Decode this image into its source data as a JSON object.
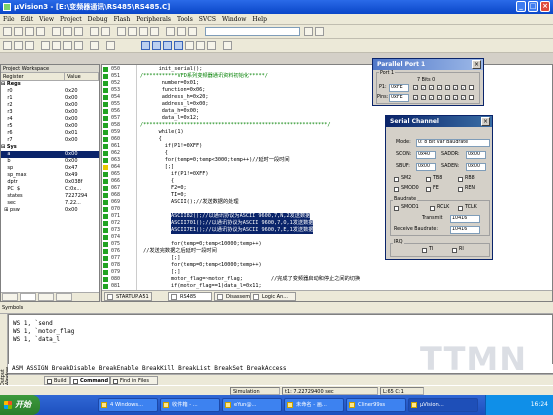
{
  "window": {
    "app_name": "RS485",
    "title": "μVision3 - [E:\\变频器通讯\\RS485\\RS485.C]",
    "controls": {
      "minimize": "_",
      "maximize": "□",
      "close": "×"
    }
  },
  "menu": [
    "File",
    "Edit",
    "View",
    "Project",
    "Debug",
    "Flash",
    "Peripherals",
    "Tools",
    "SVCS",
    "Window",
    "Help"
  ],
  "workspace": {
    "title": "Project Workspace",
    "col_register": "Register",
    "col_value": "Value",
    "rows": [
      {
        "name": "⊟ Regs",
        "value": "",
        "group": true
      },
      {
        "name": "    r0",
        "value": "0x20"
      },
      {
        "name": "    r1",
        "value": "0x00"
      },
      {
        "name": "    r2",
        "value": "0x00"
      },
      {
        "name": "    r3",
        "value": "0x00"
      },
      {
        "name": "    r4",
        "value": "0x00"
      },
      {
        "name": "    r5",
        "value": "0x00"
      },
      {
        "name": "    r6",
        "value": "0x01"
      },
      {
        "name": "    r7",
        "value": "0x00"
      },
      {
        "name": "⊟ Sys",
        "value": "",
        "group": true
      },
      {
        "name": "    a",
        "value": "0x00",
        "selected": true
      },
      {
        "name": "    b",
        "value": "0x00"
      },
      {
        "name": "    sp",
        "value": "0x47"
      },
      {
        "name": "    sp_max",
        "value": "0x49"
      },
      {
        "name": "    dptr",
        "value": "0x038f"
      },
      {
        "name": "    PC  $",
        "value": "C:0x..."
      },
      {
        "name": "    states",
        "value": "7227294"
      },
      {
        "name": "    sec",
        "value": "7.22..."
      },
      {
        "name": "  ⊞ psw",
        "value": "0x00"
      }
    ]
  },
  "editor": {
    "lines": [
      {
        "n": "050",
        "text": "init_serial();",
        "indent": 6
      },
      {
        "n": "051",
        "text": "/***********VFD系列变频器通讯资料初始化*****/",
        "indent": 0,
        "cls": "green"
      },
      {
        "n": "052",
        "text": "number=0x01;",
        "indent": 7
      },
      {
        "n": "053",
        "text": "function=0x06;",
        "indent": 7
      },
      {
        "n": "054",
        "text": "address_h=0x20;",
        "indent": 7
      },
      {
        "n": "055",
        "text": "address_l=0x00;",
        "indent": 7
      },
      {
        "n": "056",
        "text": "data_h=0x00;",
        "indent": 7
      },
      {
        "n": "057",
        "text": "data_l=0x12;",
        "indent": 7
      },
      {
        "n": "058",
        "text": "/***********************************************************/",
        "indent": 0,
        "cls": "green"
      },
      {
        "n": "059",
        "text": "while(1)",
        "indent": 6
      },
      {
        "n": "060",
        "text": "{",
        "indent": 6
      },
      {
        "n": "061",
        "text": "if(P1!=0XFF)",
        "indent": 8
      },
      {
        "n": "062",
        "text": "{",
        "indent": 8
      },
      {
        "n": "063",
        "text": "for(temp=0;temp<3000;temp++)//延时一段时间",
        "indent": 8
      },
      {
        "n": "064",
        "text": "[;]",
        "indent": 8
      },
      {
        "n": "065",
        "text": "if(P1!=0XFF)",
        "indent": 10
      },
      {
        "n": "066",
        "text": "{",
        "indent": 10
      },
      {
        "n": "067",
        "text": "F2=0;",
        "indent": 10
      },
      {
        "n": "068",
        "text": "TI=0;",
        "indent": 10
      },
      {
        "n": "069",
        "text": "ASCII();//发送数据的处理",
        "indent": 10
      },
      {
        "n": "070",
        "text": "",
        "indent": 0
      },
      {
        "n": "071",
        "text": "ASCII82();//以通讯协议为ASCII 9600,7,N,2发送数据",
        "indent": 10,
        "cls": "sel"
      },
      {
        "n": "072",
        "text": "ASCII701();//以通讯协议为ASCII 9600,7,O,1发送数据",
        "indent": 10,
        "cls": "sel"
      },
      {
        "n": "073",
        "text": "ASCII7E1();//以通讯协议为ASCII 9600,7,E,1发送数据",
        "indent": 10,
        "cls": "sel"
      },
      {
        "n": "074",
        "text": "",
        "indent": 0
      },
      {
        "n": "075",
        "text": "for(temp=0;temp<10000;temp++)",
        "indent": 10
      },
      {
        "n": "076",
        "text": "//发送完数据之后延时一段时间",
        "indent": 1
      },
      {
        "n": "077",
        "text": "[;]",
        "indent": 10
      },
      {
        "n": "078",
        "text": "for(temp=0;temp<10000;temp++)",
        "indent": 10
      },
      {
        "n": "079",
        "text": "[;]",
        "indent": 10
      },
      {
        "n": "080",
        "text": "motor_flag=~motor_flag;         //完成了变频器启动和停止之间的切换",
        "indent": 10
      },
      {
        "n": "081",
        "text": "if(motor_flag==1)data_l=0x11;",
        "indent": 10
      }
    ],
    "tabs": [
      "STARTUP.A51",
      "RS485",
      "Disassembly",
      "Logic An..."
    ]
  },
  "parallel_port": {
    "title": "Parallel Port 1",
    "group": "Port 1",
    "col_header": "7   Bits   0",
    "p1_label": "P1:",
    "p1_value": "0xFE",
    "pins_label": "Pins:",
    "pins_value": "0xFE"
  },
  "serial": {
    "title": "Serial Channel",
    "mode_label": "Mode:",
    "mode_value": "0: 8 Bit var Baudrate",
    "scon_label": "SCON:",
    "scon_value": "0x40",
    "saddr_label": "SADDR:",
    "saddr_value": "0x00",
    "sbuf_label": "SBUF:",
    "sbuf_value": "0x00",
    "saden_label": "SADEN:",
    "saden_value": "0x00",
    "flags_row1": [
      "SM2",
      "TB8",
      "RB8"
    ],
    "flags_row2": [
      "SMOD0",
      "FE",
      "REN"
    ],
    "baudrate_label": "Baudrate",
    "baud_flags": [
      "SMOD1",
      "RCLK",
      "TCLK"
    ],
    "transmit_label": "Transmit",
    "transmit_value": "10416",
    "receive_label": "Receive Baudrate:",
    "receive_value": "10416",
    "irq_label": "IRQ",
    "irq_flags": [
      "TI",
      "RI"
    ]
  },
  "symbols_label": "Symbols",
  "output": {
    "lines": [
      "WS 1, `send",
      "WS 1, `motor_flag",
      "WS 1, `data_l"
    ],
    "command_hint": "ASM ASSIGN BreakDisable BreakEnable BreakKill BreakList BreakSet BreakAccess",
    "tabs": [
      "Build",
      "Command",
      "Find in Files"
    ],
    "side_label": "Output Window"
  },
  "status": {
    "mode": "Simulation",
    "time": "t1: 7.22729400 sec",
    "pos": "L:65 C:1"
  },
  "taskbar": {
    "start": "开始",
    "tasks": [
      "4 Windows...",
      "收件箱 - ...",
      "eYun@...",
      "未命名 - 画...",
      "Cliner99ss",
      "μVision..."
    ],
    "clock": "16:24"
  },
  "watermark": "TTMN"
}
